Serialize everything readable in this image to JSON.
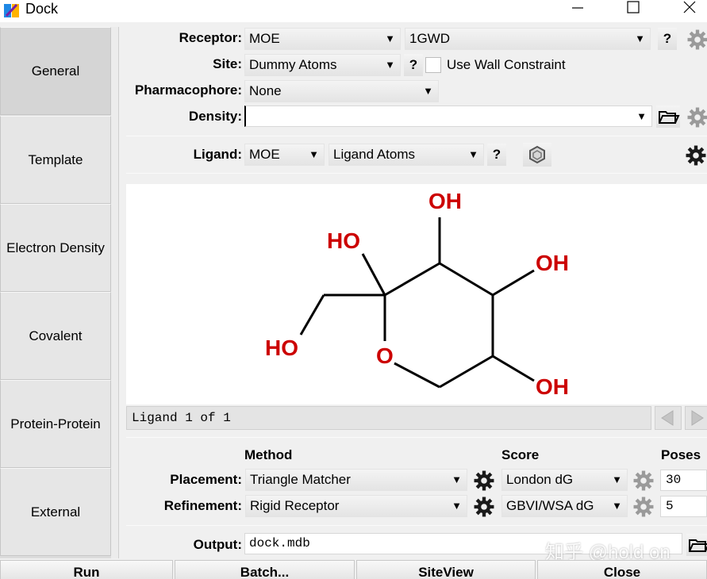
{
  "window": {
    "title": "Dock"
  },
  "sidebar": {
    "tabs": [
      {
        "label": "General",
        "active": true
      },
      {
        "label": "Template"
      },
      {
        "label": "Electron Density"
      },
      {
        "label": "Covalent"
      },
      {
        "label": "Protein-Protein"
      },
      {
        "label": "External"
      }
    ]
  },
  "receptor": {
    "label": "Receptor:",
    "source": "MOE",
    "name": "1GWD"
  },
  "site": {
    "label": "Site:",
    "value": "Dummy Atoms",
    "wall_constraint_label": "Use Wall Constraint",
    "wall_constraint_checked": false
  },
  "pharmacophore": {
    "label": "Pharmacophore:",
    "value": "None"
  },
  "density": {
    "label": "Density:",
    "value": ""
  },
  "ligand": {
    "label": "Ligand:",
    "source": "MOE",
    "atoms": "Ligand Atoms",
    "status": "Ligand 1 of 1"
  },
  "molecule": {
    "atom_labels": [
      "OH",
      "HO",
      "OH",
      "HO",
      "O",
      "OH"
    ],
    "label_color": "#cc0000"
  },
  "columns": {
    "method": "Method",
    "score": "Score",
    "poses": "Poses"
  },
  "placement": {
    "label": "Placement:",
    "method": "Triangle Matcher",
    "score": "London dG",
    "poses": "30"
  },
  "refinement": {
    "label": "Refinement:",
    "method": "Rigid Receptor",
    "score": "GBVI/WSA dG",
    "poses": "5"
  },
  "output": {
    "label": "Output:",
    "value": "dock.mdb"
  },
  "buttons": {
    "run": "Run",
    "batch": "Batch...",
    "siteview": "SiteView",
    "close": "Close"
  },
  "help_label": "?",
  "dropdown_arrow": "▼",
  "watermark": "知乎 @hold on"
}
